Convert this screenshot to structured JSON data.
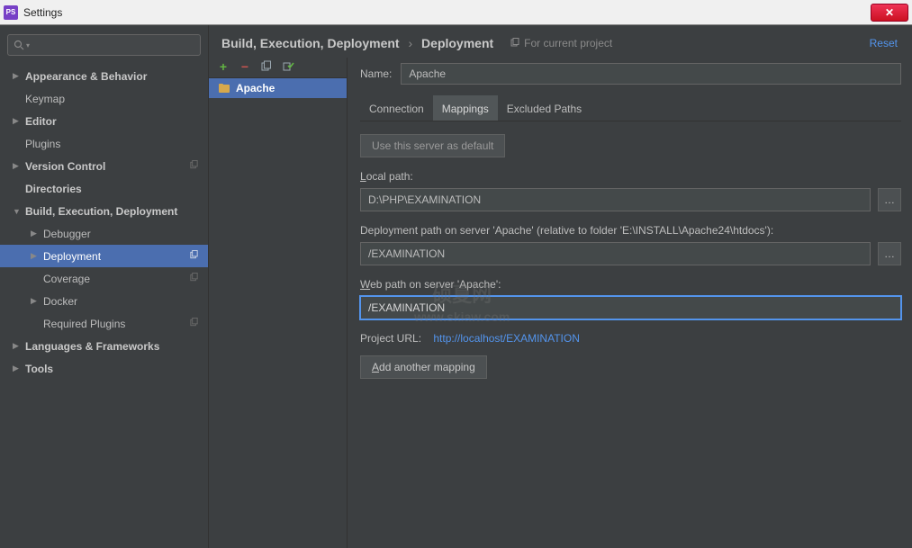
{
  "window": {
    "app_badge": "PS",
    "title": "Settings",
    "close_glyph": "✕"
  },
  "sidebar": {
    "search_placeholder": "Q",
    "items": [
      {
        "label": "Appearance & Behavior",
        "bold": true,
        "arrow": "▶",
        "indent": 0
      },
      {
        "label": "Keymap",
        "bold": false,
        "arrow": "",
        "indent": 0
      },
      {
        "label": "Editor",
        "bold": true,
        "arrow": "▶",
        "indent": 0
      },
      {
        "label": "Plugins",
        "bold": false,
        "arrow": "",
        "indent": 0
      },
      {
        "label": "Version Control",
        "bold": true,
        "arrow": "▶",
        "indent": 0,
        "copy": true
      },
      {
        "label": "Directories",
        "bold": true,
        "arrow": "",
        "indent": 0
      },
      {
        "label": "Build, Execution, Deployment",
        "bold": true,
        "arrow": "▼",
        "indent": 0
      },
      {
        "label": "Debugger",
        "bold": false,
        "arrow": "▶",
        "indent": 1
      },
      {
        "label": "Deployment",
        "bold": false,
        "arrow": "▶",
        "indent": 1,
        "selected": true,
        "copy": true
      },
      {
        "label": "Coverage",
        "bold": false,
        "arrow": "",
        "indent": 1,
        "copy": true
      },
      {
        "label": "Docker",
        "bold": false,
        "arrow": "▶",
        "indent": 1
      },
      {
        "label": "Required Plugins",
        "bold": false,
        "arrow": "",
        "indent": 1,
        "copy": true
      },
      {
        "label": "Languages & Frameworks",
        "bold": true,
        "arrow": "▶",
        "indent": 0
      },
      {
        "label": "Tools",
        "bold": true,
        "arrow": "▶",
        "indent": 0
      }
    ]
  },
  "breadcrumb": {
    "part1": "Build, Execution, Deployment",
    "part2": "Deployment",
    "for_project": "For current project",
    "reset": "Reset"
  },
  "servers": {
    "items": [
      {
        "name": "Apache"
      }
    ]
  },
  "form": {
    "name_label": "Name:",
    "name_value": "Apache",
    "tabs": [
      {
        "label": "Connection"
      },
      {
        "label": "Mappings",
        "active": true
      },
      {
        "label": "Excluded Paths"
      }
    ],
    "default_btn": "Use this server as default",
    "local_path_label_pre": "L",
    "local_path_label_rest": "ocal path:",
    "local_path_value": "D:\\PHP\\EXAMINATION",
    "deploy_path_label": "Deployment path on server 'Apache' (relative to folder 'E:\\INSTALL\\Apache24\\htdocs'):",
    "deploy_path_value": "/EXAMINATION",
    "web_path_label_pre": "W",
    "web_path_label_rest": "eb path on server 'Apache':",
    "web_path_value": "/EXAMINATION",
    "project_url_label": "Project URL:",
    "project_url_value": "http://localhost/EXAMINATION",
    "add_mapping_btn_pre": "A",
    "add_mapping_btn_rest": "dd another mapping"
  },
  "watermark": {
    "line1": "硕夏网",
    "line2": "www.skiaw.com"
  }
}
